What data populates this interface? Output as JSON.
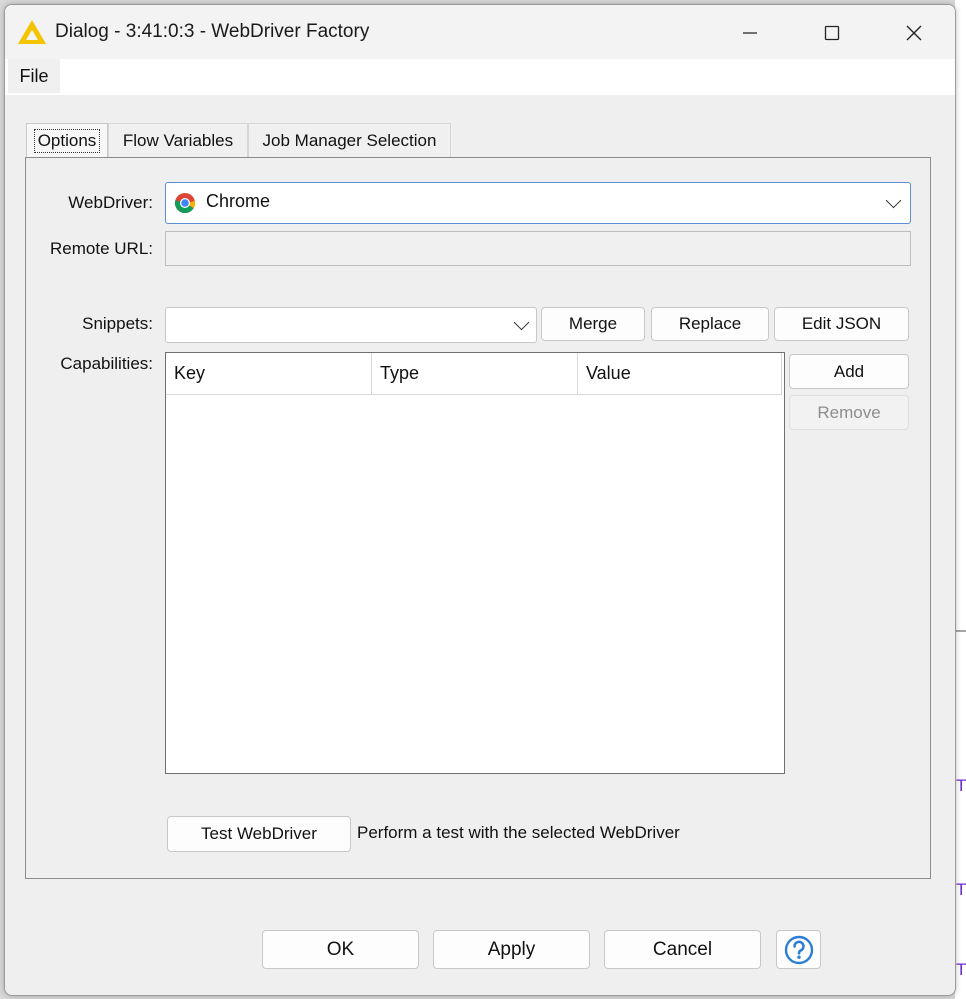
{
  "window": {
    "title": "Dialog - 3:41:0:3 - WebDriver Factory"
  },
  "menu": {
    "file": "File"
  },
  "tabs": [
    {
      "label": "Options",
      "active": true
    },
    {
      "label": "Flow Variables",
      "active": false
    },
    {
      "label": "Job Manager Selection",
      "active": false
    }
  ],
  "options": {
    "webdriver_label": "WebDriver:",
    "webdriver_value": "Chrome",
    "remote_url_label": "Remote URL:",
    "remote_url_value": "",
    "snippets_label": "Snippets:",
    "snippets_value": "",
    "merge_button": "Merge",
    "replace_button": "Replace",
    "edit_json_button": "Edit JSON",
    "capabilities_label": "Capabilities:",
    "columns": [
      "Key",
      "Type",
      "Value"
    ],
    "rows": [],
    "add_button": "Add",
    "remove_button": "Remove",
    "test_button": "Test WebDriver",
    "test_description": "Perform a test with the selected WebDriver"
  },
  "footer": {
    "ok": "OK",
    "apply": "Apply",
    "cancel": "Cancel",
    "help_icon": "help-icon"
  },
  "background": {
    "edge_letter": "T"
  },
  "colors": {
    "knime_yellow": "#f5c400",
    "focus_border": "#5a8fd6",
    "help_blue": "#2a7fd4"
  }
}
